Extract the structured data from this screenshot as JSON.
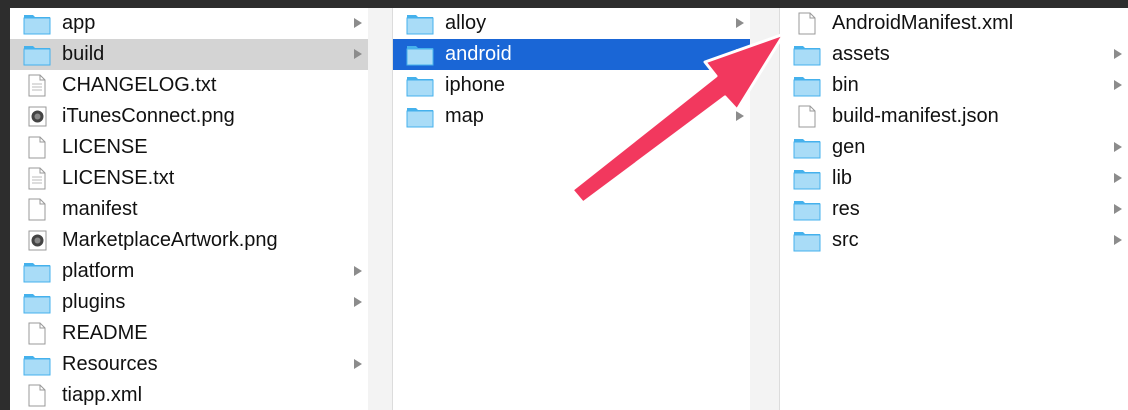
{
  "columns": [
    {
      "items": [
        {
          "name": "app",
          "type": "folder",
          "chevron": true
        },
        {
          "name": "build",
          "type": "folder",
          "chevron": true,
          "selected": "gray"
        },
        {
          "name": "CHANGELOG.txt",
          "type": "text"
        },
        {
          "name": "iTunesConnect.png",
          "type": "image"
        },
        {
          "name": "LICENSE",
          "type": "file"
        },
        {
          "name": "LICENSE.txt",
          "type": "text"
        },
        {
          "name": "manifest",
          "type": "file"
        },
        {
          "name": "MarketplaceArtwork.png",
          "type": "image"
        },
        {
          "name": "platform",
          "type": "folder",
          "chevron": true
        },
        {
          "name": "plugins",
          "type": "folder",
          "chevron": true
        },
        {
          "name": "README",
          "type": "file"
        },
        {
          "name": "Resources",
          "type": "folder",
          "chevron": true
        },
        {
          "name": "tiapp.xml",
          "type": "file"
        }
      ]
    },
    {
      "items": [
        {
          "name": "alloy",
          "type": "folder",
          "chevron": true
        },
        {
          "name": "android",
          "type": "folder",
          "chevron": true,
          "selected": "blue"
        },
        {
          "name": "iphone",
          "type": "folder"
        },
        {
          "name": "map",
          "type": "folder",
          "chevron": true
        }
      ]
    },
    {
      "items": [
        {
          "name": "AndroidManifest.xml",
          "type": "file"
        },
        {
          "name": "assets",
          "type": "folder",
          "chevron": true
        },
        {
          "name": "bin",
          "type": "folder",
          "chevron": true
        },
        {
          "name": "build-manifest.json",
          "type": "file"
        },
        {
          "name": "gen",
          "type": "folder",
          "chevron": true
        },
        {
          "name": "lib",
          "type": "folder",
          "chevron": true
        },
        {
          "name": "res",
          "type": "folder",
          "chevron": true
        },
        {
          "name": "src",
          "type": "folder",
          "chevron": true
        }
      ]
    }
  ],
  "colors": {
    "selection_blue": "#1a66d6",
    "selection_gray": "#d4d4d4",
    "folder_light": "#a9dcf7",
    "folder_dark": "#45b1ec",
    "annotation_arrow": "#f2385e"
  }
}
